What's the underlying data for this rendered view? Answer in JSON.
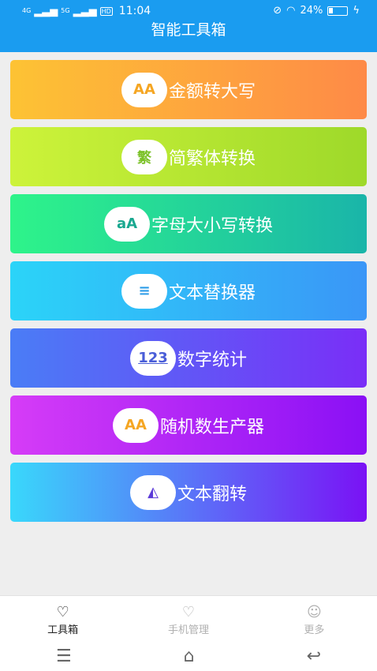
{
  "status": {
    "net1": "4G",
    "net2": "5G",
    "hd": "HD",
    "time": "11:04",
    "battery_text": "24%"
  },
  "title": "智能工具箱",
  "tools": [
    {
      "label": "金额转大写",
      "badge": "AA",
      "badge_color": "#f5a623"
    },
    {
      "label": "简繁体转换",
      "badge": "繁",
      "badge_color": "#7cc22a"
    },
    {
      "label": "字母大小写转换",
      "badge": "aA",
      "badge_color": "#1aa890"
    },
    {
      "label": "文本替换器",
      "badge": "≡",
      "badge_color": "#2b9be8"
    },
    {
      "label": "数字统计",
      "badge": "123",
      "badge_color": "#4a5ed8"
    },
    {
      "label": "随机数生产器",
      "badge": "AA",
      "badge_color": "#f5a623"
    },
    {
      "label": "文本翻转",
      "badge": "◭",
      "badge_color": "#5b3ad8"
    }
  ],
  "tabs": [
    {
      "label": "工具箱",
      "icon": "♡"
    },
    {
      "label": "手机管理",
      "icon": "♡"
    },
    {
      "label": "更多",
      "icon": "☺"
    }
  ],
  "nav": {
    "menu": "☰",
    "home": "⌂",
    "back": "↩"
  }
}
